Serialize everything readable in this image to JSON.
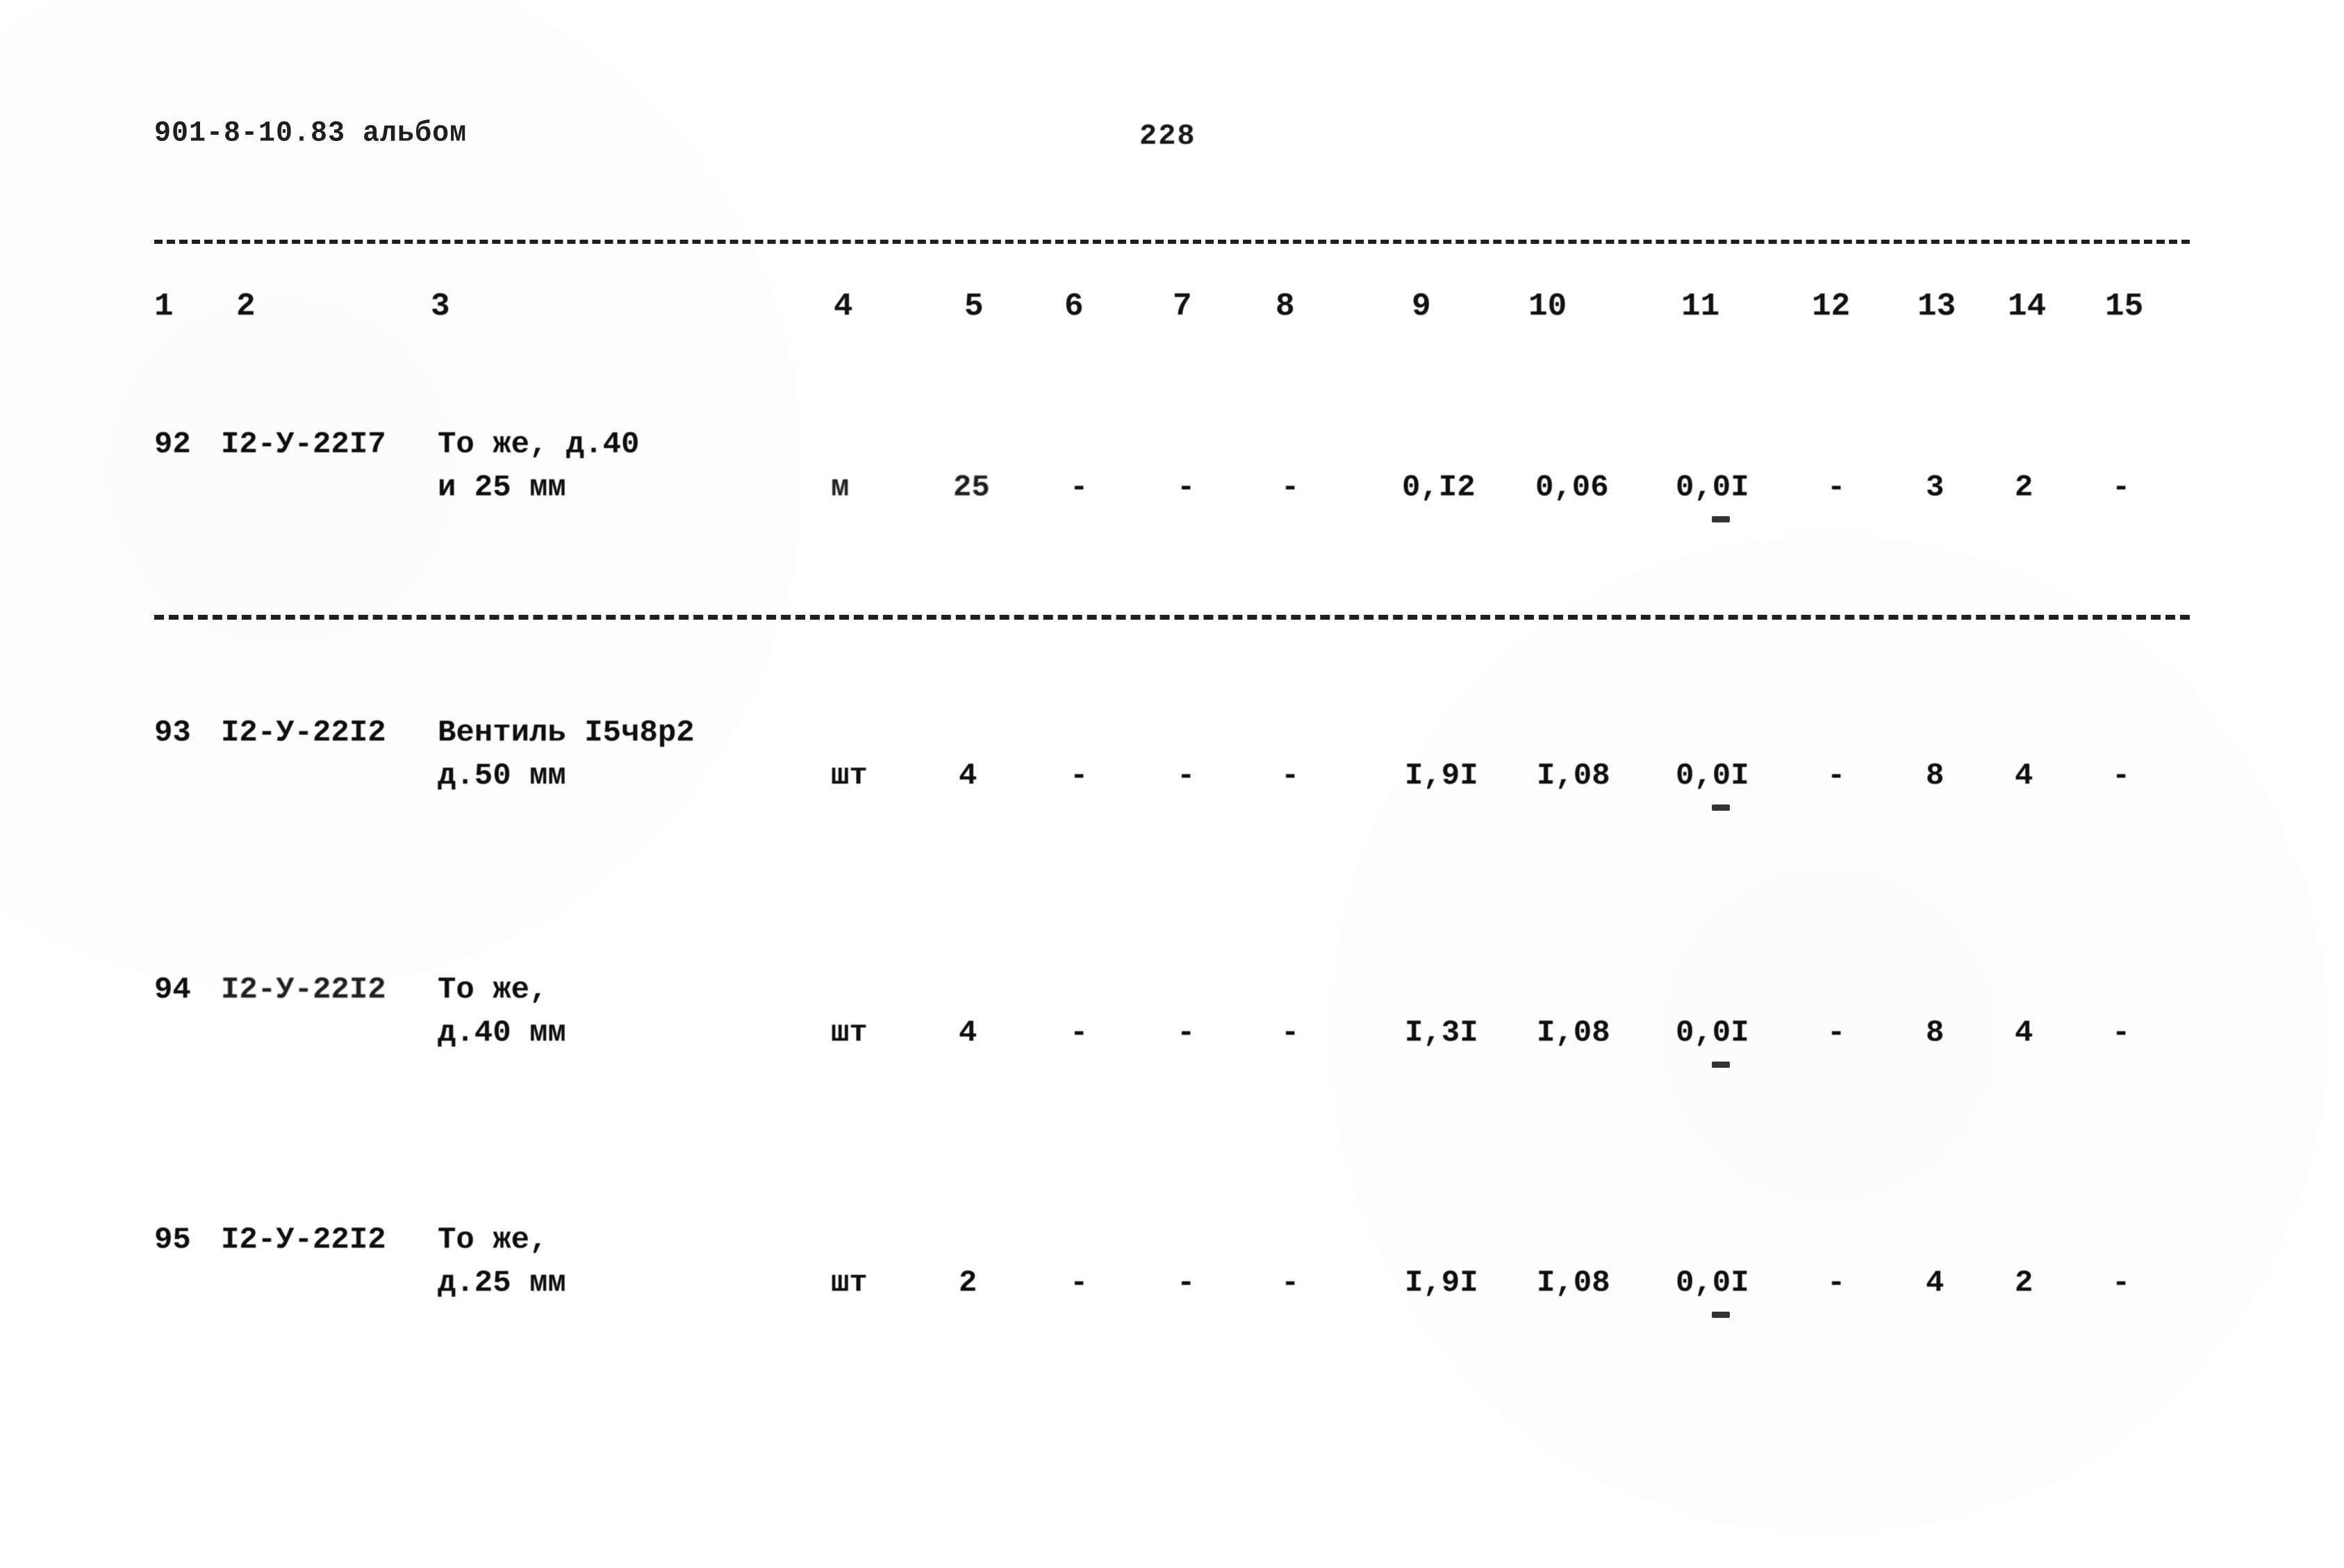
{
  "header": {
    "doc_code": "901-8-10.83 альбом",
    "page_number": "228"
  },
  "table": {
    "column_numbers": [
      "1",
      "2",
      "3",
      "4",
      "5",
      "6",
      "7",
      "8",
      "9",
      "10",
      "11",
      "12",
      "13",
      "14",
      "15"
    ],
    "rows": [
      {
        "no": "92",
        "code": "I2-У-22I7",
        "desc_line1": "То же, д.40",
        "desc_line2": "и 25 мм",
        "unit": "м",
        "qty": "25",
        "c6": "-",
        "c7": "-",
        "c8": "-",
        "c9": "0,I2",
        "c10": "0,06",
        "c11": "0,0I",
        "c12": "-",
        "c13": "3",
        "c14": "2",
        "c15": "-"
      },
      {
        "no": "93",
        "code": "I2-У-22I2",
        "desc_line1": "Вентиль I5ч8р2",
        "desc_line2": "д.50 мм",
        "unit": "шт",
        "qty": "4",
        "c6": "-",
        "c7": "-",
        "c8": "-",
        "c9": "I,9I",
        "c10": "I,08",
        "c11": "0,0I",
        "c12": "-",
        "c13": "8",
        "c14": "4",
        "c15": "-"
      },
      {
        "no": "94",
        "code": "I2-У-22I2",
        "desc_line1": "То же,",
        "desc_line2": "д.40 мм",
        "unit": "шт",
        "qty": "4",
        "c6": "-",
        "c7": "-",
        "c8": "-",
        "c9": "I,3I",
        "c10": "I,08",
        "c11": "0,0I",
        "c12": "-",
        "c13": "8",
        "c14": "4",
        "c15": "-"
      },
      {
        "no": "95",
        "code": "I2-У-22I2",
        "desc_line1": "То же,",
        "desc_line2": "д.25 мм",
        "unit": "шт",
        "qty": "2",
        "c6": "-",
        "c7": "-",
        "c8": "-",
        "c9": "I,9I",
        "c10": "I,08",
        "c11": "0,0I",
        "c12": "-",
        "c13": "4",
        "c14": "2",
        "c15": "-"
      }
    ]
  }
}
